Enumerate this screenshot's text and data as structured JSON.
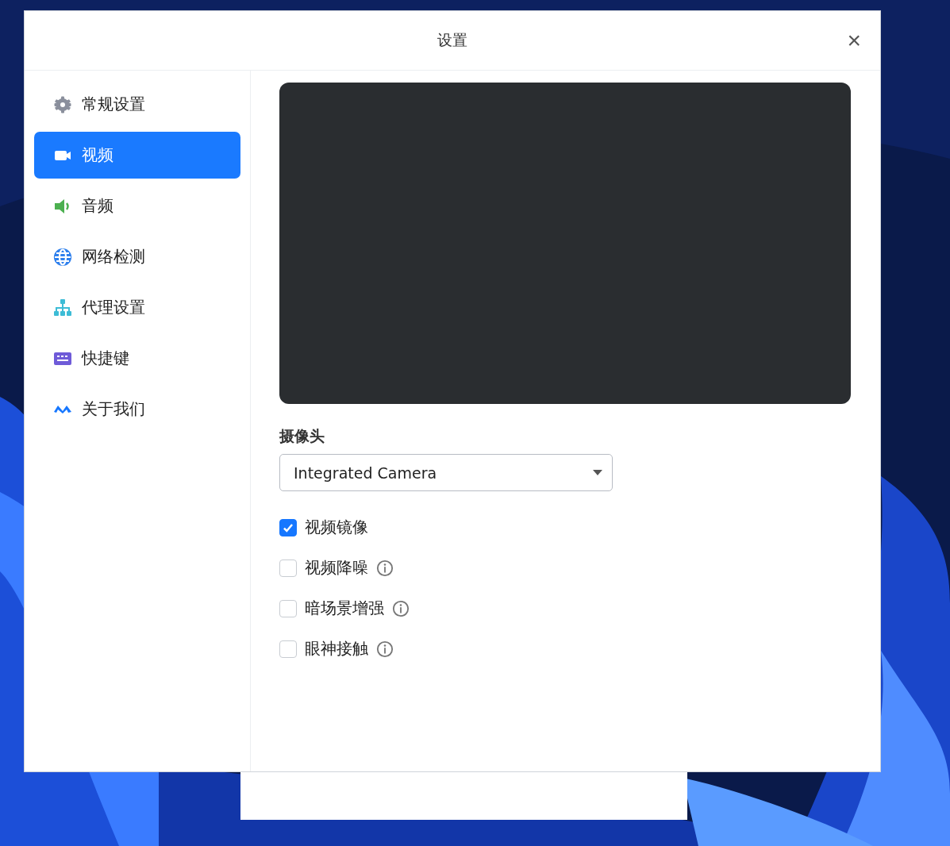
{
  "window": {
    "title": "设置",
    "close": "×"
  },
  "sidebar": {
    "items": [
      {
        "label": "常规设置",
        "selected": false
      },
      {
        "label": "视频",
        "selected": true
      },
      {
        "label": "音频",
        "selected": false
      },
      {
        "label": "网络检测",
        "selected": false
      },
      {
        "label": "代理设置",
        "selected": false
      },
      {
        "label": "快捷键",
        "selected": false
      },
      {
        "label": "关于我们",
        "selected": false
      }
    ]
  },
  "camera": {
    "label": "摄像头",
    "value": "Integrated Camera"
  },
  "options": [
    {
      "label": "视频镜像",
      "checked": true,
      "info": false
    },
    {
      "label": "视频降噪",
      "checked": false,
      "info": true
    },
    {
      "label": "暗场景增强",
      "checked": false,
      "info": true
    },
    {
      "label": "眼神接触",
      "checked": false,
      "info": true
    }
  ]
}
